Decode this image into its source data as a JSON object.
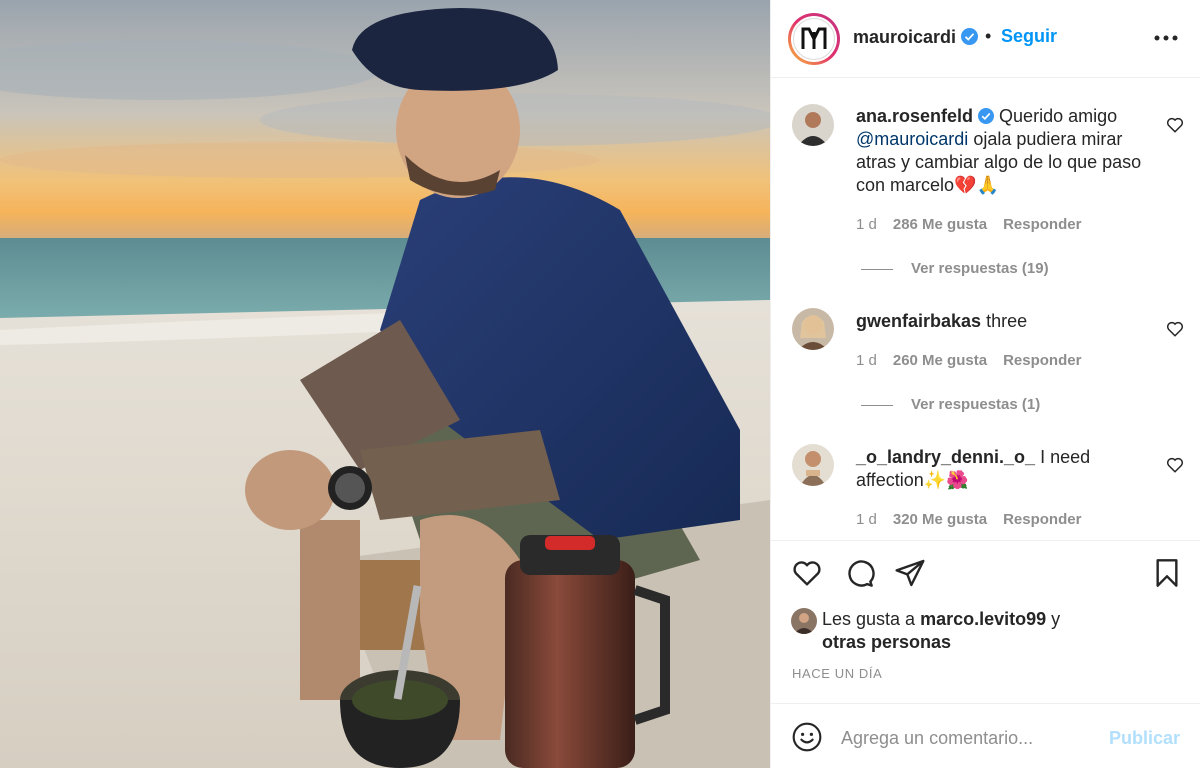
{
  "header": {
    "username": "mauroicardi",
    "separator": "•",
    "follow_label": "Seguir"
  },
  "comments": [
    {
      "username": "ana.rosenfeld",
      "text_before": " Querido amigo ",
      "mention": "@mauroicardi",
      "text_after": " ojala pudiera mirar atras y cambiar algo de lo que paso con marcelo💔🙏",
      "time": "1 d",
      "likes": "286 Me gusta",
      "reply_label": "Responder",
      "view_replies": "Ver respuestas (19)"
    },
    {
      "username": "gwenfairbakas",
      "text": " three",
      "time": "1 d",
      "likes": "260 Me gusta",
      "reply_label": "Responder",
      "view_replies": "Ver respuestas (1)"
    },
    {
      "username": "_o_landry_denni._o_",
      "text": " I need affection✨🌺",
      "time": "1 d",
      "likes": "320 Me gusta",
      "reply_label": "Responder"
    }
  ],
  "likes_section": {
    "prefix": "Les gusta a ",
    "user": "marco.levito99",
    "middle": " y ",
    "others": "otras personas"
  },
  "timestamp": "HACE UN DÍA",
  "add_comment": {
    "placeholder": "Agrega un comentario...",
    "publish_label": "Publicar"
  },
  "colors": {
    "accent": "#0095f6",
    "text": "#262626",
    "muted": "#8e8e8e",
    "publish_disabled": "#b2dffc",
    "mention": "#00376b"
  }
}
